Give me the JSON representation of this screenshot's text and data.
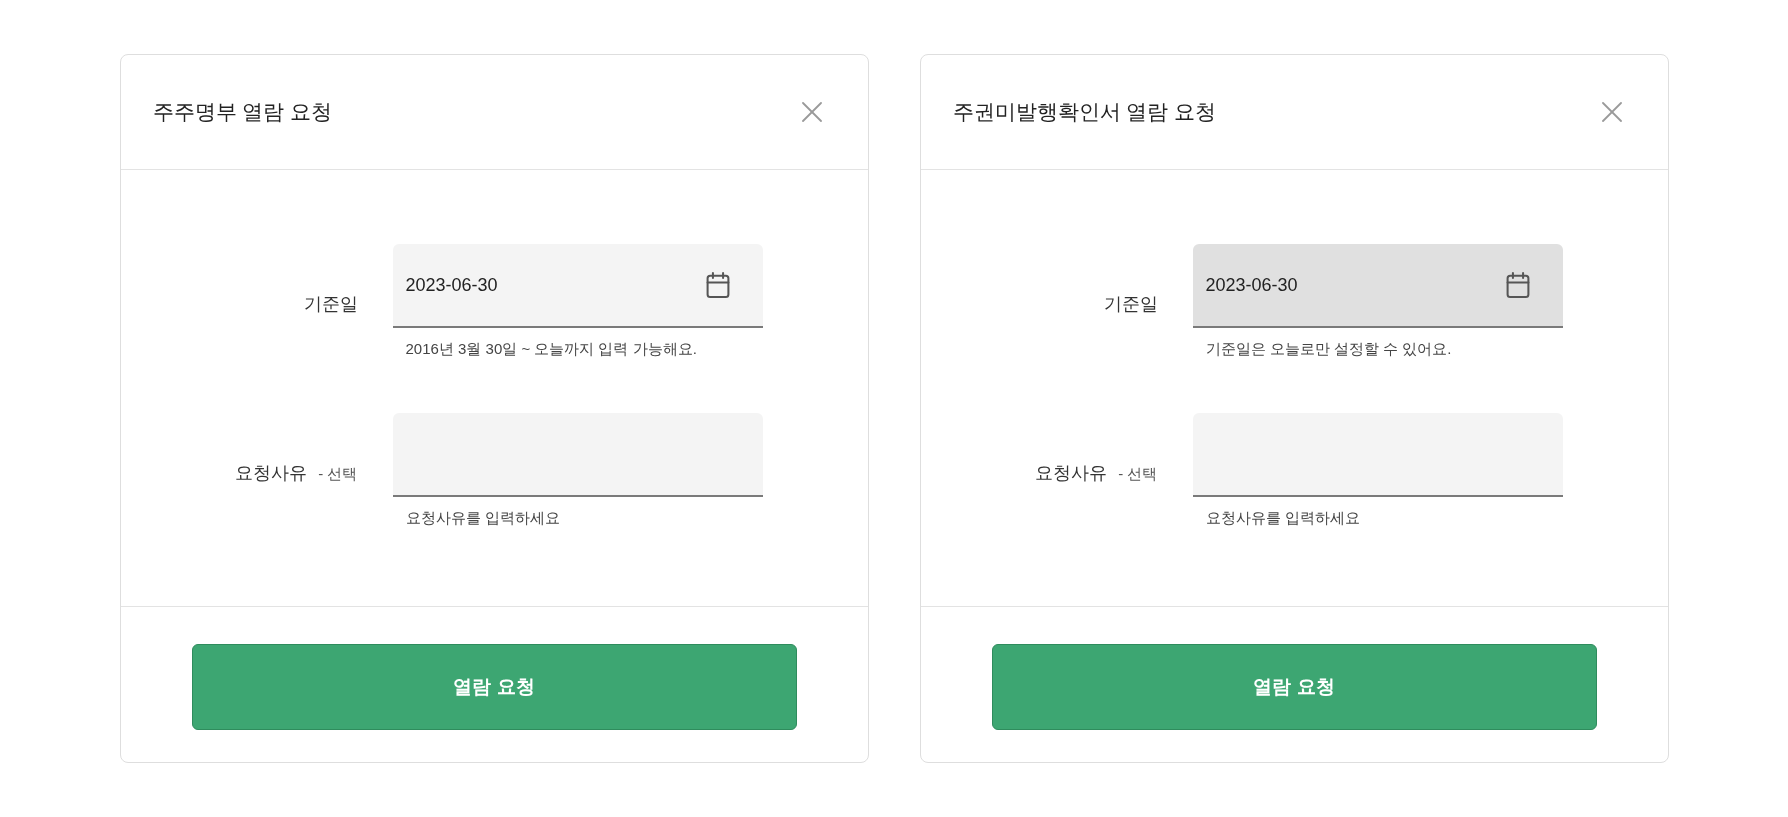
{
  "dialogs": [
    {
      "title": "주주명부 열람 요청",
      "fields": [
        {
          "kind": "date",
          "label": "기준일",
          "value": "2023-06-30",
          "helper": "2016년 3월 30일 ~ 오늘까지 입력 가능해요.",
          "disabled": false
        },
        {
          "kind": "text",
          "label": "요청사유",
          "label_note": "- 선택",
          "helper": "요청사유를 입력하세요",
          "disabled": false
        }
      ],
      "submit_button": "열람 요청"
    },
    {
      "title": "주권미발행확인서 열람 요청",
      "fields": [
        {
          "kind": "date",
          "label": "기준일",
          "value": "2023-06-30",
          "helper": "기준일은 오늘로만 설정할 수 있어요.",
          "disabled": true
        },
        {
          "kind": "text",
          "label": "요청사유",
          "label_note": "- 선택",
          "helper": "요청사유를 입력하세요",
          "disabled": false
        }
      ],
      "submit_button": "열람 요청"
    }
  ]
}
